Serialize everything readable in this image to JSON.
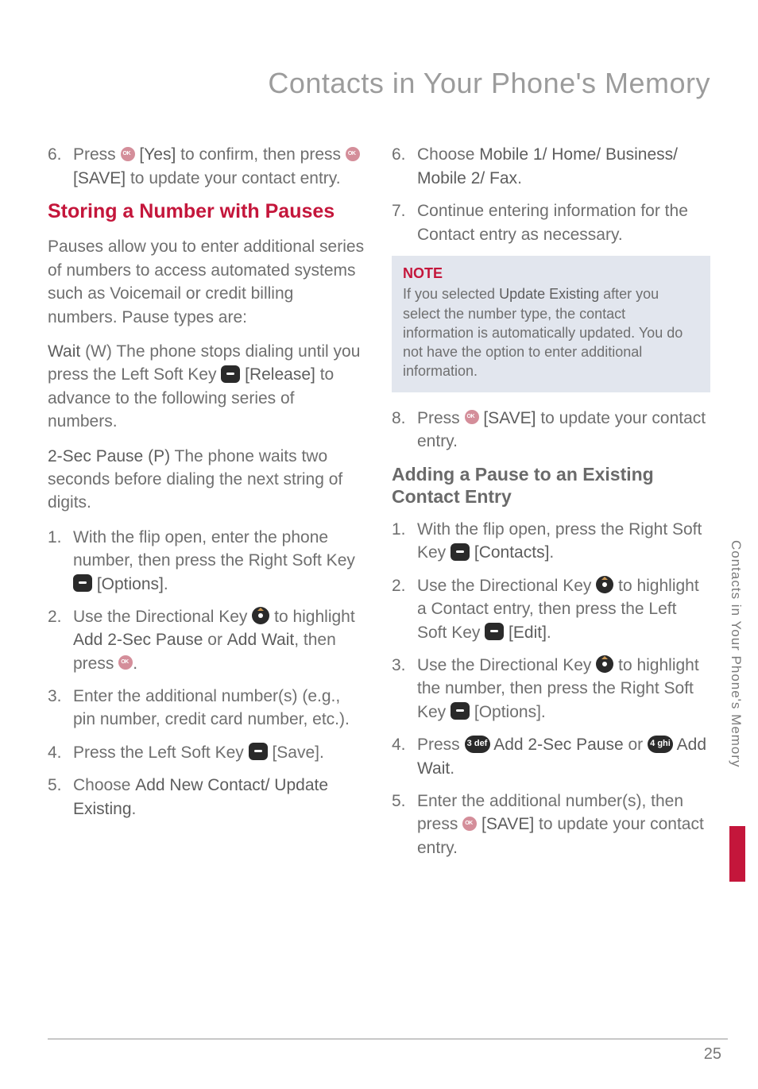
{
  "title": "Contacts in Your Phone's Memory",
  "sideTab": "Contacts in Your Phone's Memory",
  "pageNumber": "25",
  "left": {
    "step6_a": "Press ",
    "step6_b": " [Yes]",
    "step6_c": " to confirm, then press ",
    "step6_d": " [SAVE]",
    "step6_e": " to update your contact entry.",
    "heading": "Storing a Number with Pauses",
    "intro": "Pauses allow you to enter additional series of numbers to access automated systems such as Voicemail or credit billing numbers. Pause types are:",
    "wait_label": "Wait",
    "wait_text": " (W) The phone stops dialing until you press the Left Soft Key ",
    "wait_release": " [Release]",
    "wait_after": " to advance to the following series of numbers.",
    "pause_label": "2-Sec Pause (P)",
    "pause_text": " The phone waits two seconds before dialing the next string of digits.",
    "s1_a": "With the flip open, enter the phone number, then press the Right Soft Key ",
    "s1_b": " [Options]",
    "s1_c": ".",
    "s2_a": "Use the Directional Key ",
    "s2_b": " to highlight ",
    "s2_c": "Add 2-Sec Pause",
    "s2_d": " or ",
    "s2_e": "Add Wait",
    "s2_f": ", then press ",
    "s2_g": ".",
    "s3": "Enter the additional number(s) (e.g., pin number, credit card number, etc.).",
    "s4_a": "Press the Left Soft Key ",
    "s4_b": " [Save].",
    "s5_a": "Choose ",
    "s5_b": "Add New Contact/ Update Existing",
    "s5_c": "."
  },
  "right": {
    "s6_a": "Choose ",
    "s6_b": "Mobile 1/ Home/ Business/ Mobile 2/ Fax",
    "s6_c": ".",
    "s7": "Continue entering information for the Contact entry as necessary.",
    "noteTitle": "NOTE",
    "note_a": "If you selected ",
    "note_b": "Update Existing",
    "note_c": " after you select the number type, the contact information is automatically updated. You do not have the option to enter additional information.",
    "s8_a": "Press ",
    "s8_b": " [SAVE]",
    "s8_c": " to update your contact entry.",
    "heading": "Adding a Pause to an Existing Contact Entry",
    "r1_a": "With the flip open, press the Right Soft Key ",
    "r1_b": " [Contacts]",
    "r1_c": ".",
    "r2_a": "Use the Directional Key ",
    "r2_b": " to highlight a Contact entry, then press the Left Soft Key ",
    "r2_c": " [Edit]",
    "r2_d": ".",
    "r3_a": "Use the Directional Key ",
    "r3_b": " to highlight the number, then press the Right Soft Key ",
    "r3_c": " [Options].",
    "r4_a": "Press ",
    "r4_key3": "3 def",
    "r4_b": " Add 2-Sec Pause",
    "r4_c": " or ",
    "r4_key4": "4 ghi",
    "r4_d": " Add Wait",
    "r4_e": ".",
    "r5_a": "Enter the additional number(s), then press ",
    "r5_b": " [SAVE]",
    "r5_c": " to update your contact entry."
  }
}
